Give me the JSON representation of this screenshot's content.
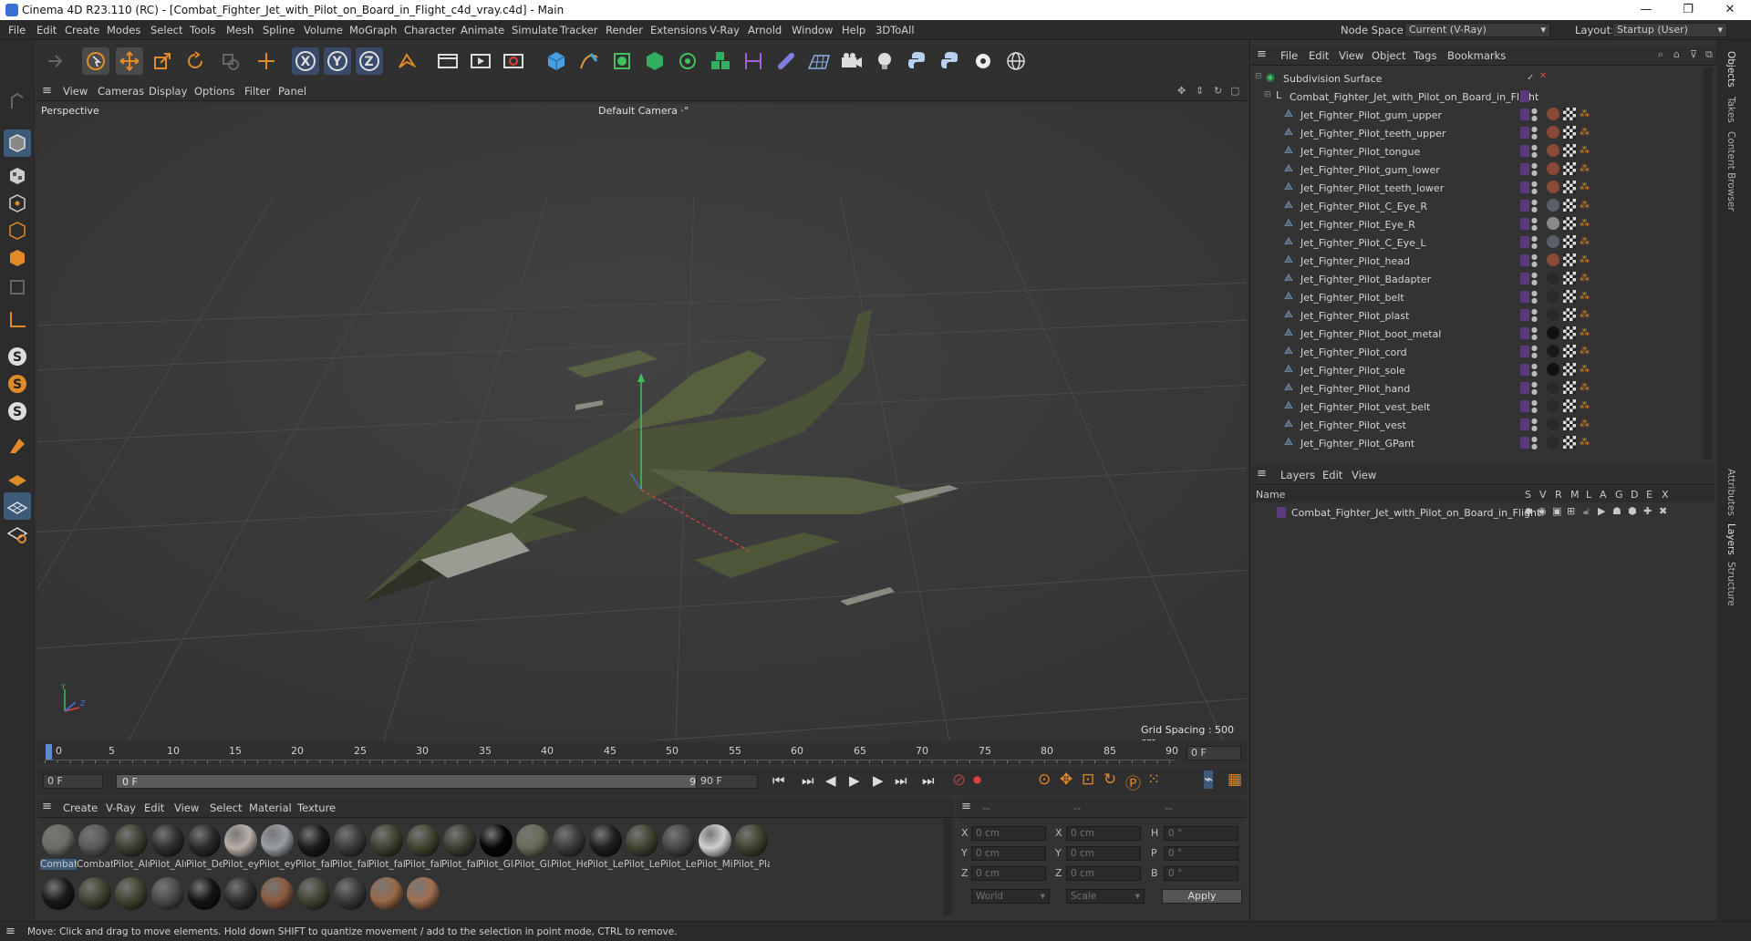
{
  "window": {
    "title": "Cinema 4D R23.110 (RC) - [Combat_Fighter_Jet_with_Pilot_on_Board_in_Flight_c4d_vray.c4d] - Main",
    "minimize": "—",
    "maximize": "❐",
    "close": "✕"
  },
  "menu": [
    "File",
    "Edit",
    "Create",
    "Modes",
    "Select",
    "Tools",
    "Mesh",
    "Spline",
    "Volume",
    "MoGraph",
    "Character",
    "Animate",
    "Simulate",
    "Tracker",
    "Render",
    "Extensions",
    "V-Ray",
    "Arnold",
    "Window",
    "Help",
    "3DToAll"
  ],
  "nodespace": {
    "label": "Node Space:",
    "value": "Current (V-Ray)"
  },
  "layout": {
    "label": "Layout:",
    "value": "Startup (User)"
  },
  "viewport": {
    "menu": [
      "View",
      "Cameras",
      "Display",
      "Options",
      "Filter",
      "Panel"
    ],
    "view_name": "Perspective",
    "camera": "Default Camera",
    "grid_spacing": "Grid Spacing : 500 cm"
  },
  "timeline": {
    "ticks": [
      "0",
      "5",
      "10",
      "15",
      "20",
      "25",
      "30",
      "35",
      "40",
      "45",
      "50",
      "55",
      "60",
      "65",
      "70",
      "75",
      "80",
      "85",
      "90"
    ],
    "current_frame": "0 F",
    "start": "0 F",
    "range_start": "0 F",
    "range_end": "90 F",
    "end": "90 F",
    "end_right": "0 F"
  },
  "materials": {
    "menu": [
      "Create",
      "V-Ray",
      "Edit",
      "View",
      "Select",
      "Material",
      "Texture"
    ],
    "row1": [
      {
        "label": "Combat",
        "color": "#6a6e62"
      },
      {
        "label": "Combat_",
        "color": "#585858"
      },
      {
        "label": "Pilot_Alu",
        "color": "#3c4030"
      },
      {
        "label": "Pilot_Alu",
        "color": "#2e2e2e"
      },
      {
        "label": "Pilot_De",
        "color": "#2a2a2a"
      },
      {
        "label": "Pilot_eye",
        "color": "#b8b0a8"
      },
      {
        "label": "Pilot_eye",
        "color": "#9a9ea4"
      },
      {
        "label": "Pilot_fab",
        "color": "#1a1a1a"
      },
      {
        "label": "Pilot_fab",
        "color": "#3a3a3a"
      },
      {
        "label": "Pilot_fab",
        "color": "#3d4230"
      },
      {
        "label": "Pilot_fab",
        "color": "#40452f"
      },
      {
        "label": "Pilot_fab",
        "color": "#3b3f31"
      },
      {
        "label": "Pilot_Gla",
        "color": "#050505"
      },
      {
        "label": "Pilot_Gla",
        "color": "#6a6a58"
      },
      {
        "label": "Pilot_He",
        "color": "#3a3a3a"
      },
      {
        "label": "Pilot_Lea",
        "color": "#1e1e1e"
      },
      {
        "label": "Pilot_Lea",
        "color": "#3f4430"
      },
      {
        "label": "Pilot_Lea",
        "color": "#464646"
      },
      {
        "label": "Pilot_Mir",
        "color": "#d0d0d0"
      },
      {
        "label": "Pilot_Pla",
        "color": "#40442f"
      }
    ],
    "row2": [
      {
        "color": "#1a1a1a"
      },
      {
        "color": "#3e4230"
      },
      {
        "color": "#40452f"
      },
      {
        "color": "#4a4a4a"
      },
      {
        "color": "#141414"
      },
      {
        "color": "#2e2e2e"
      },
      {
        "color": "#8a5a40"
      },
      {
        "color": "#3f4432"
      },
      {
        "color": "#3a3a3a"
      },
      {
        "color": "#9a6a48"
      },
      {
        "color": "#a06e50"
      }
    ]
  },
  "coords": {
    "headers": [
      "--",
      "--",
      "--"
    ],
    "rows": [
      {
        "a": "X",
        "av": "0 cm",
        "b": "X",
        "bv": "0 cm",
        "c": "H",
        "cv": "0 °"
      },
      {
        "a": "Y",
        "av": "0 cm",
        "b": "Y",
        "bv": "0 cm",
        "c": "P",
        "cv": "0 °"
      },
      {
        "a": "Z",
        "av": "0 cm",
        "b": "Z",
        "bv": "0 cm",
        "c": "B",
        "cv": "0 °"
      }
    ],
    "world": "World",
    "scale": "Scale",
    "apply": "Apply"
  },
  "objects": {
    "menu": [
      "File",
      "Edit",
      "View",
      "Object",
      "Tags",
      "Bookmarks"
    ],
    "root": "Subdivision Surface",
    "group": "Combat_Fighter_Jet_with_Pilot_on_Board_in_Flight",
    "items": [
      {
        "name": "Jet_Fighter_Pilot_gum_upper",
        "tag": "#8a4a38"
      },
      {
        "name": "Jet_Fighter_Pilot_teeth_upper",
        "tag": "#8a4a38"
      },
      {
        "name": "Jet_Fighter_Pilot_tongue",
        "tag": "#8a4a38"
      },
      {
        "name": "Jet_Fighter_Pilot_gum_lower",
        "tag": "#8a4a38"
      },
      {
        "name": "Jet_Fighter_Pilot_teeth_lower",
        "tag": "#8a4a38"
      },
      {
        "name": "Jet_Fighter_Pilot_C_Eye_R",
        "tag": "#5a6068"
      },
      {
        "name": "Jet_Fighter_Pilot_Eye_R",
        "tag": "#8a8a8a"
      },
      {
        "name": "Jet_Fighter_Pilot_C_Eye_L",
        "tag": "#5a6068"
      },
      {
        "name": "Jet_Fighter_Pilot_head",
        "tag": "#8a4a38"
      },
      {
        "name": "Jet_Fighter_Pilot_Badapter",
        "tag": "#2a2a2a"
      },
      {
        "name": "Jet_Fighter_Pilot_belt",
        "tag": "#2a2a2a"
      },
      {
        "name": "Jet_Fighter_Pilot_plast",
        "tag": "#2a2a2a"
      },
      {
        "name": "Jet_Fighter_Pilot_boot_metal",
        "tag": "#111111"
      },
      {
        "name": "Jet_Fighter_Pilot_cord",
        "tag": "#1a1a1a"
      },
      {
        "name": "Jet_Fighter_Pilot_sole",
        "tag": "#111111"
      },
      {
        "name": "Jet_Fighter_Pilot_hand",
        "tag": "#2a2a2a"
      },
      {
        "name": "Jet_Fighter_Pilot_vest_belt",
        "tag": "#2a2a2a"
      },
      {
        "name": "Jet_Fighter_Pilot_vest",
        "tag": "#2a2a2a"
      },
      {
        "name": "Jet_Fighter_Pilot_GPant",
        "tag": "#2a2a2a"
      }
    ]
  },
  "layers": {
    "menu": [
      "Layers",
      "Edit",
      "View"
    ],
    "name_header": "Name",
    "flags": [
      "S",
      "V",
      "R",
      "M",
      "L",
      "A",
      "G",
      "D",
      "E",
      "X"
    ],
    "row": "Combat_Fighter_Jet_with_Pilot_on_Board_in_Flight"
  },
  "sidetabs": [
    "Objects",
    "Takes",
    "Content Browser",
    "Attributes",
    "Layers",
    "Structure"
  ],
  "status": "Move: Click and drag to move elements. Hold down SHIFT to quantize movement / add to the selection in point mode, CTRL to remove."
}
